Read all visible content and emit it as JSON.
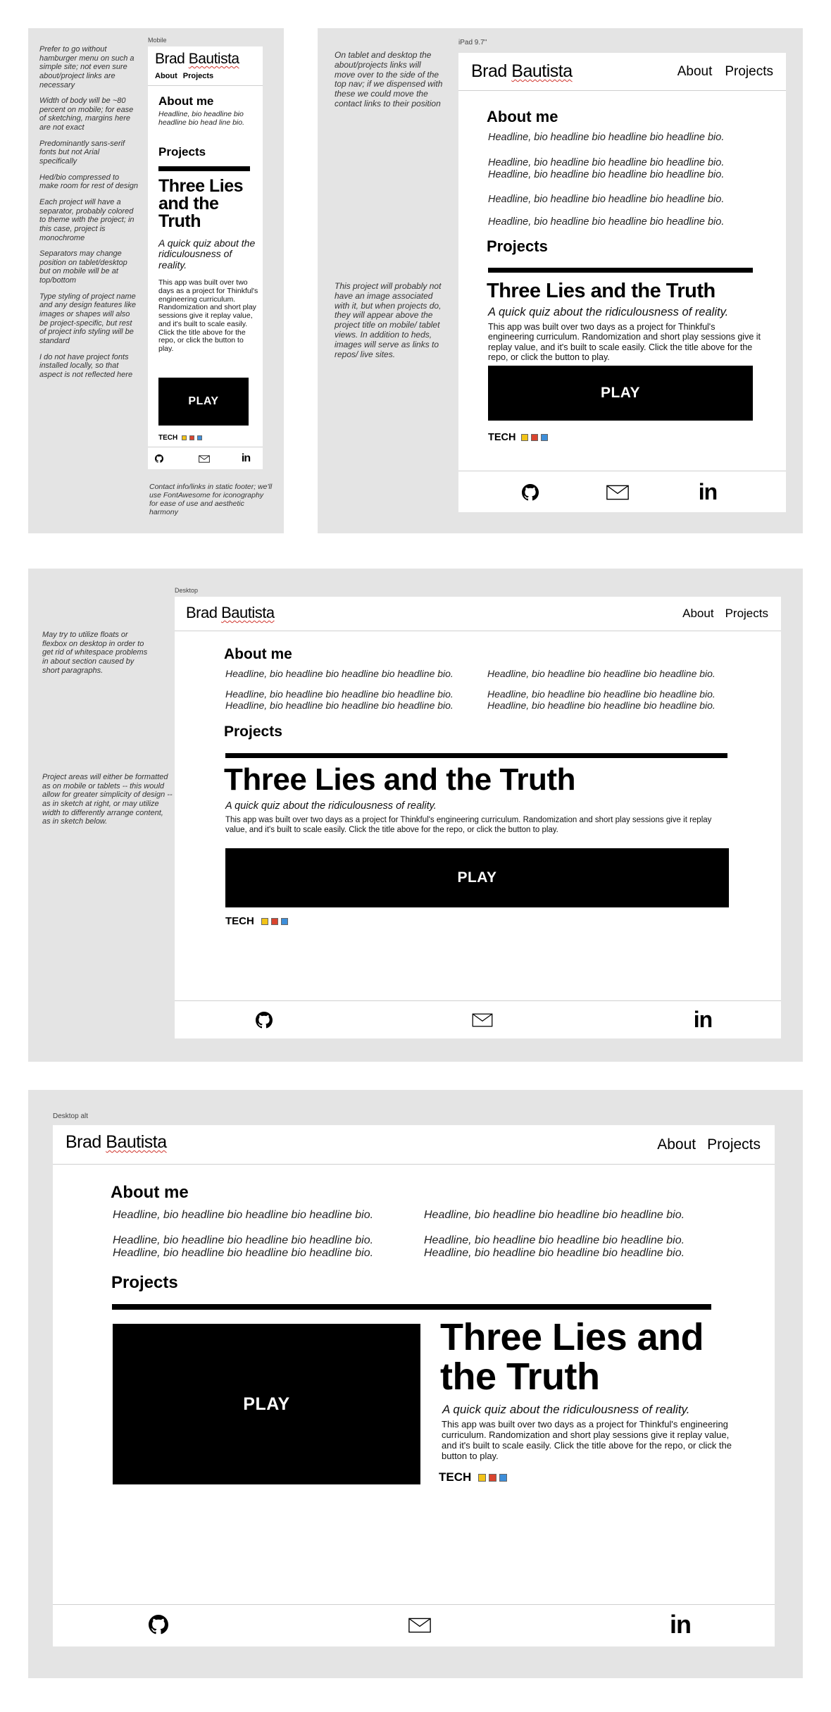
{
  "frames": {
    "mobile": "Mobile",
    "ipad": "iPad 9.7\"",
    "desktop": "Desktop",
    "desktop_alt": "Desktop alt"
  },
  "site": {
    "name_first": "Brad ",
    "name_last": "Bautista",
    "nav_about": "About",
    "nav_projects": "Projects",
    "about_heading": "About me",
    "projects_heading": "Projects",
    "bio_line": "Headline, bio headline bio headline bio headline bio.",
    "mobile_bio": "Headline, bio headline bio headline bio head line bio.",
    "project_title": "Three Lies and the Truth",
    "project_tagline": "A quick quiz about the ridiculousness of reality.",
    "project_desc": "This app was built over two days as a project for Thinkful's engineering curriculum. Randomization and short play sessions give it replay value, and it's built to scale easily. Click the title above for the repo, or click the button to play.",
    "play_label": "PLAY",
    "tech_label": "TECH",
    "linkedin_label": "in"
  },
  "notes": {
    "mobile": [
      "Prefer to go without hamburger menu on such a simple site; not even sure about/project links are necessary",
      "Width of body will be ~80 percent on mobile; for ease of sketching, margins here are not exact",
      "Predominantly sans-serif fonts but not Arial specifically",
      "Hed/bio compressed to make room for rest of design",
      "Each project will have a separator, probably colored to theme with the project; in this case, project is monochrome",
      "Separators may change position on tablet/desktop but on mobile will be at top/bottom",
      "Type styling of project name and any design features like images or shapes will also be project-specific, but rest of project info styling will be standard",
      "I do not have project fonts installed locally, so that aspect is not reflected here"
    ],
    "mobile_footer": "Contact info/links in static footer; we'll use FontAwesome for iconography for ease of use and aesthetic harmony",
    "ipad_1": "On tablet and desktop the about/projects links will move over to the side of the top nav; if we dispensed with these we could move the contact links to their position",
    "ipad_2": "This project will probably not have an image associated with it, but when projects do, they will appear above the project title on mobile/ tablet views. In addition to heds, images will serve as links to repos/ live sites.",
    "desktop_1": "May try to utilize floats or flexbox on desktop in order to get rid of whitespace problems in about section caused by short paragraphs.",
    "desktop_2": "Project areas will either be formatted as on mobile or tablets -- this would allow for greater simplicity of design -- as in sketch at right, or may utilize width to differently arrange content, as in sketch below."
  },
  "icons": {
    "github": "github-icon",
    "mail": "envelope-icon",
    "linkedin": "linkedin-icon",
    "tech_colors": [
      "#f2c318",
      "#d9442e",
      "#3d8ed9"
    ]
  }
}
